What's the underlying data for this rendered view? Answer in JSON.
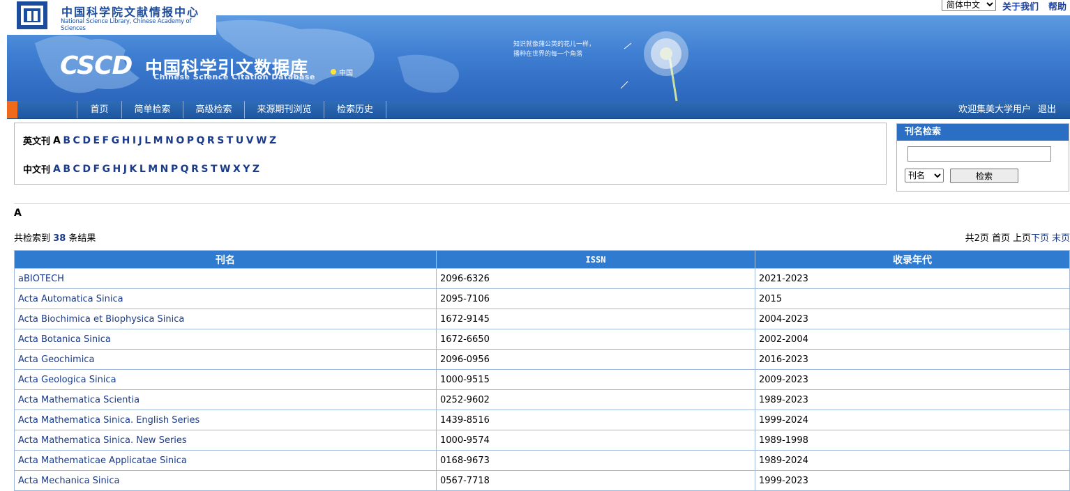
{
  "header": {
    "language": "简体中文",
    "about_label": "关于我们",
    "help_label": "帮助"
  },
  "logo": {
    "org_cn": "中国科学院文献情报中心",
    "org_en": "National Science Library, Chinese Academy of Sciences"
  },
  "banner": {
    "logo_text": "CSCD",
    "title_cn": "中国科学引文数据库",
    "title_en": "Chinese Science Citation Database",
    "region_label": "中国",
    "slogan": "知识就像蒲公英的花儿一样，\n播种在世界的每一个角落"
  },
  "nav": {
    "items": [
      "首页",
      "简单检索",
      "高级检索",
      "来源期刊浏览",
      "检索历史"
    ],
    "welcome": "欢迎集美大学用户",
    "logout": "退出"
  },
  "alphabet": {
    "en_label": "英文刊",
    "en_letters": [
      "A",
      "B",
      "C",
      "D",
      "E",
      "F",
      "G",
      "H",
      "I",
      "J",
      "L",
      "M",
      "N",
      "O",
      "P",
      "Q",
      "R",
      "S",
      "T",
      "U",
      "V",
      "W",
      "Z"
    ],
    "cn_label": "中文刊",
    "cn_letters": [
      "A",
      "B",
      "C",
      "D",
      "F",
      "G",
      "H",
      "J",
      "K",
      "L",
      "M",
      "N",
      "P",
      "Q",
      "R",
      "S",
      "T",
      "W",
      "X",
      "Y",
      "Z"
    ]
  },
  "search_panel": {
    "title": "刊名检索",
    "input_value": "",
    "field_option": "刊名",
    "button_label": "检索"
  },
  "results": {
    "current_letter": "A",
    "count_prefix": "共检索到",
    "count": "38",
    "count_suffix": "条结果",
    "pager": {
      "total_pages": "共2页",
      "first": "首页",
      "prev": "上页",
      "next": "下页",
      "last": "末页"
    },
    "columns": [
      "刊名",
      "ISSN",
      "收录年代"
    ],
    "rows": [
      [
        "aBIOTECH",
        "2096-6326",
        "2021-2023"
      ],
      [
        "Acta Automatica Sinica",
        "2095-7106",
        "2015"
      ],
      [
        "Acta Biochimica et Biophysica Sinica",
        "1672-9145",
        "2004-2023"
      ],
      [
        "Acta Botanica Sinica",
        "1672-6650",
        "2002-2004"
      ],
      [
        "Acta Geochimica",
        "2096-0956",
        "2016-2023"
      ],
      [
        "Acta Geologica Sinica",
        "1000-9515",
        "2009-2023"
      ],
      [
        "Acta Mathematica Scientia",
        "0252-9602",
        "1989-2023"
      ],
      [
        "Acta Mathematica Sinica. English Series",
        "1439-8516",
        "1999-2024"
      ],
      [
        "Acta Mathematica Sinica. New Series",
        "1000-9574",
        "1989-1998"
      ],
      [
        "Acta Mathematicae Applicatae Sinica",
        "0168-9673",
        "1989-2024"
      ],
      [
        "Acta Mechanica Sinica",
        "0567-7718",
        "1999-2023"
      ]
    ]
  },
  "colors": {
    "nav_blue": "#1e56a0",
    "header_blue": "#2e7bd0",
    "link_blue": "#1a3a8a",
    "accent_orange": "#f06a1c"
  }
}
